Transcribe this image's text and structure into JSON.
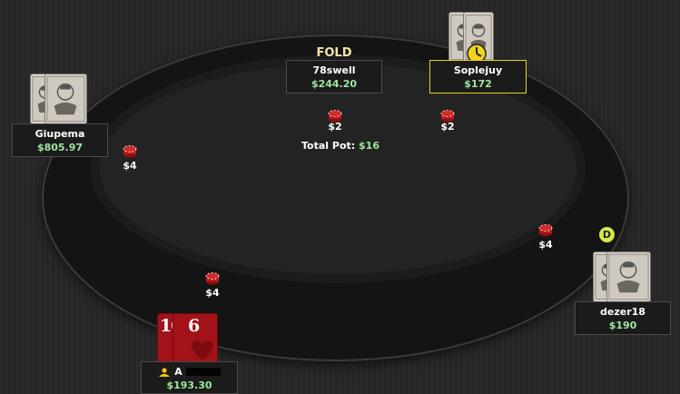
{
  "action_label": "FOLD",
  "pot": {
    "label": "Total Pot:",
    "amount": "$16"
  },
  "dealer_label": "D",
  "players": {
    "top_center": {
      "name": "78swell",
      "stack": "$244.20"
    },
    "top_right": {
      "name": "Soplejuy",
      "stack": "$172"
    },
    "left": {
      "name": "Giupema",
      "stack": "$805.97"
    },
    "right": {
      "name": "dezer18",
      "stack": "$190"
    },
    "hero": {
      "name": "A",
      "stack": "$193.30",
      "cards": [
        "10",
        "6"
      ],
      "card_suit": "hearts"
    }
  },
  "bets": {
    "top_center": "$2",
    "top_right": "$2",
    "left": "$4",
    "right": "$4",
    "hero": "$4"
  },
  "colors": {
    "stack_green": "#9fe79f",
    "active_border": "#e8d21e",
    "hero_card_red": "#a31218",
    "dealer_button": "#d9e64a"
  },
  "icons": [
    "card-back-icon",
    "chip-icon",
    "timer-icon",
    "user-icon",
    "heart-icon"
  ]
}
